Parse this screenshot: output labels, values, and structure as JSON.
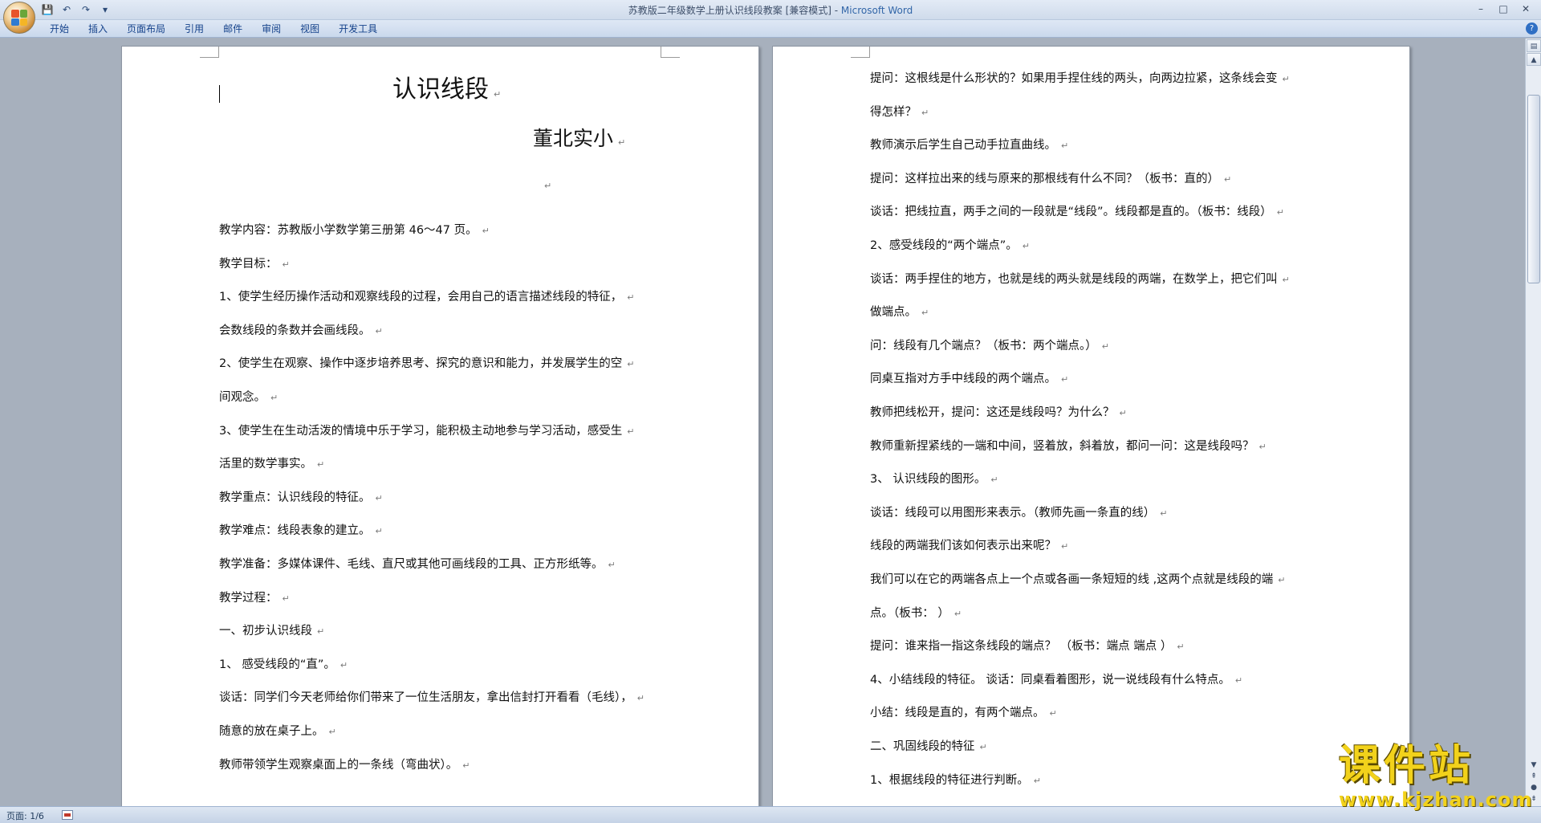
{
  "window": {
    "title": "苏教版二年级数学上册认识线段教案 [兼容模式] - ",
    "app_name": "Microsoft Word",
    "minimize_glyph": "–",
    "maximize_glyph": "□",
    "close_glyph": "✕"
  },
  "quick_access": {
    "save_glyph": "💾",
    "undo_glyph": "↶",
    "redo_glyph": "↷",
    "customize_glyph": "▾"
  },
  "ribbon": {
    "tabs": [
      "开始",
      "插入",
      "页面布局",
      "引用",
      "邮件",
      "审阅",
      "视图",
      "开发工具"
    ],
    "help_glyph": "?"
  },
  "document": {
    "left_page": {
      "title": "认识线段",
      "author": "董北实小",
      "lines": [
        "教学内容：苏教版小学数学第三册第 46～47 页。",
        "教学目标：",
        "1、使学生经历操作活动和观察线段的过程，会用自己的语言描述线段的特征，",
        "会数线段的条数并会画线段。",
        "2、使学生在观察、操作中逐步培养思考、探究的意识和能力，并发展学生的空",
        "间观念。",
        "3、使学生在生动活泼的情境中乐于学习，能积极主动地参与学习活动，感受生",
        "活里的数学事实。",
        "教学重点：认识线段的特征。",
        "教学难点：线段表象的建立。",
        "教学准备：多媒体课件、毛线、直尺或其他可画线段的工具、正方形纸等。",
        "教学过程：",
        "一、初步认识线段",
        "1、 感受线段的“直”。",
        "谈话：同学们今天老师给你们带来了一位生活朋友，拿出信封打开看看（毛线），",
        "随意的放在桌子上。",
        "教师带领学生观察桌面上的一条线（弯曲状）。"
      ]
    },
    "right_page": {
      "lines": [
        "提问：这根线是什么形状的？如果用手捏住线的两头，向两边拉紧，这条线会变",
        "得怎样？",
        "教师演示后学生自己动手拉直曲线。",
        "提问：这样拉出来的线与原来的那根线有什么不同？（板书：直的）",
        "谈话：把线拉直，两手之间的一段就是“线段”。线段都是直的。（板书：线段）",
        "2、感受线段的“两个端点”。",
        "谈话：两手捏住的地方，也就是线的两头就是线段的两端，在数学上，把它们叫",
        "做端点。",
        "问：线段有几个端点？（板书：两个端点。）",
        "同桌互指对方手中线段的两个端点。",
        "教师把线松开，提问：这还是线段吗？为什么？",
        "教师重新捏紧线的一端和中间，竖着放，斜着放，都问一问：这是线段吗？",
        "3、 认识线段的图形。",
        "谈话：线段可以用图形来表示。（教师先画一条直的线）",
        "线段的两端我们该如何表示出来呢？",
        "我们可以在它的两端各点上一个点或各画一条短短的线 ,这两个点就是线段的端",
        "点。（板书：        ）",
        "提问：谁来指一指这条线段的端点？      （板书：端点      端点 ）",
        "   4、小结线段的特征。      谈话：同桌看着图形，说一说线段有什么特点。",
        "小结：线段是直的，有两个端点。",
        "二、巩固线段的特征",
        "1、根据线段的特征进行判断。"
      ]
    }
  },
  "statusbar": {
    "page_info": "页面: 1/6"
  },
  "watermark": {
    "main": "课件站",
    "url": "www.kjzhan.com"
  },
  "colors": {
    "ribbon_text": "#15428b",
    "app_background": "#a7b0bd",
    "watermark": "#f2d21b"
  }
}
